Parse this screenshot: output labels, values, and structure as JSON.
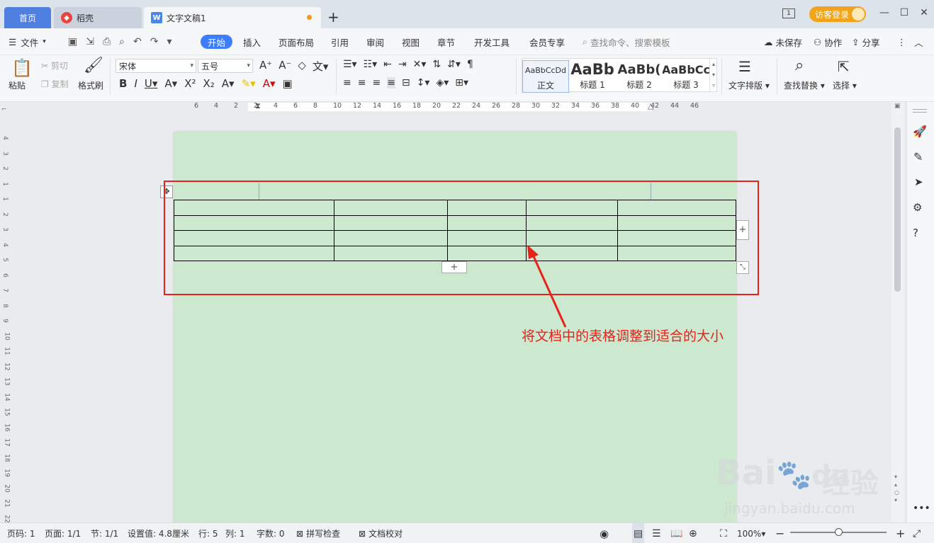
{
  "tabs": {
    "home": "首页",
    "daoke": "稻壳",
    "doc": "文字文稿1",
    "plus": "+"
  },
  "titlebar": {
    "page_indicator": "1",
    "login": "访客登录",
    "minimize": "—",
    "maximize": "☐",
    "close": "✕"
  },
  "menu": {
    "file": "文件",
    "items": [
      "开始",
      "插入",
      "页面布局",
      "引用",
      "审阅",
      "视图",
      "章节",
      "开发工具",
      "会员专享"
    ],
    "search_placeholder": "查找命令、搜索模板",
    "unsaved": "未保存",
    "collab": "协作",
    "share": "分享",
    "more": "⋮",
    "collapse": "︿"
  },
  "ribbon": {
    "paste": "粘贴",
    "cut": "剪切",
    "copy": "复制",
    "format_painter": "格式刷",
    "font": "宋体",
    "size": "五号",
    "styles": [
      {
        "preview": "AaBbCcDd",
        "name": "正文"
      },
      {
        "preview": "AaBb",
        "name": "标题 1"
      },
      {
        "preview": "AaBb(",
        "name": "标题 2"
      },
      {
        "preview": "AaBbCc",
        "name": "标题 3"
      }
    ],
    "text_layout": "文字排版",
    "find_replace": "查找替换",
    "select": "选择"
  },
  "ruler": {
    "h": [
      "6",
      "4",
      "2",
      "2",
      "4",
      "6",
      "8",
      "10",
      "12",
      "14",
      "16",
      "18",
      "20",
      "22",
      "24",
      "26",
      "28",
      "30",
      "32",
      "34",
      "36",
      "38",
      "40",
      "42",
      "44",
      "46"
    ],
    "v": [
      "4",
      "3",
      "2",
      "1",
      "1",
      "2",
      "3",
      "4",
      "5",
      "6",
      "7",
      "8",
      "9",
      "10",
      "11",
      "12",
      "13",
      "14",
      "15",
      "16",
      "17",
      "18",
      "19",
      "20",
      "21",
      "22"
    ]
  },
  "table": {
    "rows": 4,
    "cols": 5
  },
  "annotation": "将文档中的表格调整到适合的大小",
  "status": {
    "page_num": "页码: 1",
    "pages": "页面: 1/1",
    "section": "节: 1/1",
    "setting": "设置值: 4.8厘米",
    "row": "行: 5",
    "col": "列: 1",
    "words": "字数: 0",
    "spell": "拼写检查",
    "proof": "文档校对",
    "zoom": "100%"
  },
  "watermark": {
    "brand": "Bai",
    "brand2": "经验",
    "url": "jingyan.baidu.com",
    "du": "du"
  },
  "colors": {
    "accent": "#3d7eff",
    "page": "#cce8cf",
    "annotation": "#e8221b",
    "login": "#f1a41a"
  }
}
